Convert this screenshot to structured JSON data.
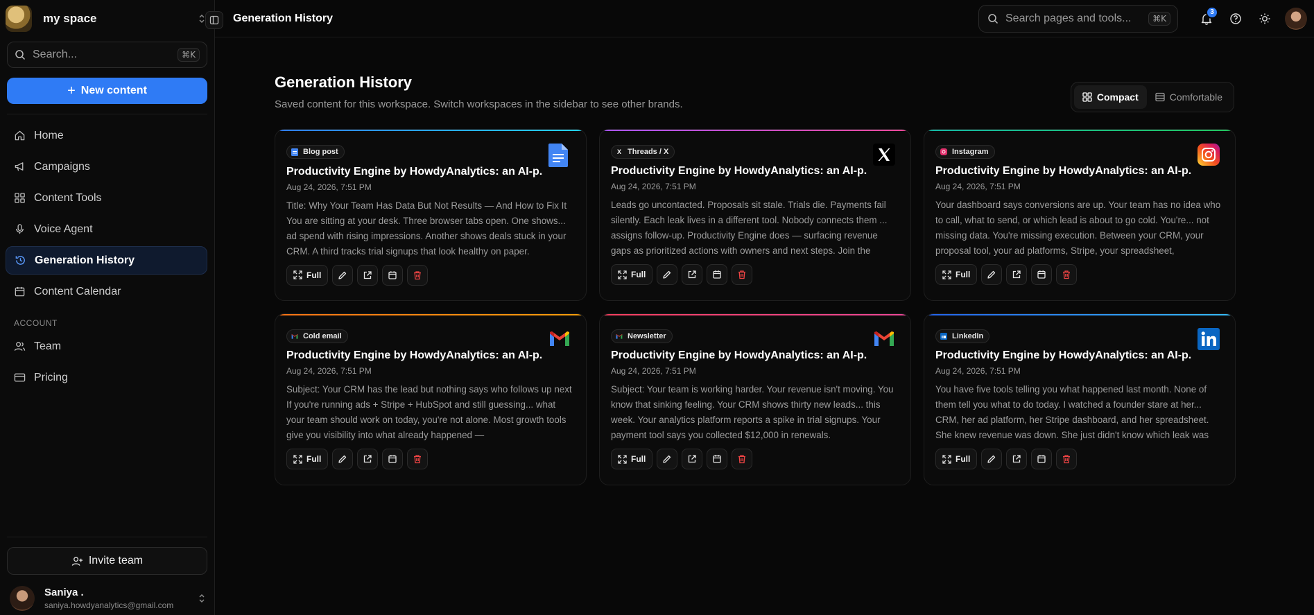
{
  "workspace": {
    "name": "my space"
  },
  "sidebar": {
    "search_placeholder": "Search...",
    "search_shortcut": "⌘K",
    "new_content_label": "New content",
    "nav": [
      {
        "label": "Home",
        "icon": "home-icon"
      },
      {
        "label": "Campaigns",
        "icon": "megaphone-icon"
      },
      {
        "label": "Content Tools",
        "icon": "grid-icon"
      },
      {
        "label": "Voice Agent",
        "icon": "mic-icon"
      },
      {
        "label": "Generation History",
        "icon": "history-icon",
        "active": true
      },
      {
        "label": "Content Calendar",
        "icon": "calendar-icon"
      }
    ],
    "account_label": "ACCOUNT",
    "account_nav": [
      {
        "label": "Team",
        "icon": "users-icon"
      },
      {
        "label": "Pricing",
        "icon": "card-icon"
      }
    ],
    "invite_label": "Invite team",
    "user": {
      "name": "Saniya .",
      "email": "saniya.howdyanalytics@gmail.com"
    }
  },
  "topbar": {
    "title": "Generation History",
    "search_placeholder": "Search pages and tools...",
    "search_shortcut": "⌘K",
    "notification_count": "3"
  },
  "page": {
    "title": "Generation History",
    "subtitle": "Saved content for this workspace. Switch workspaces in the sidebar to see other brands.",
    "view_compact": "Compact",
    "view_comfortable": "Comfortable"
  },
  "colors": {
    "accent": "#2f7bf5",
    "delete": "#ef4444"
  },
  "cards": [
    {
      "type": "Blog post",
      "icon": "google-docs-icon",
      "accent": "linear-gradient(90deg,#2f7bf5,#22d3ee)",
      "title": "Productivity Engine by HowdyAnalytics: an AI-p...",
      "date": "Aug 24, 2026, 7:51 PM",
      "body": "Title: Why Your Team Has Data But Not Results — And How to Fix It You are sitting at your desk. Three browser tabs open. One shows... ad spend with rising impressions. Another shows deals stuck in your CRM. A third tracks trial signups that look healthy on paper.",
      "full_label": "Full"
    },
    {
      "type": "Threads / X",
      "icon": "x-icon",
      "accent": "linear-gradient(90deg,#a855f7,#ec4899)",
      "title": "Productivity Engine by HowdyAnalytics: an AI-p...",
      "date": "Aug 24, 2026, 7:51 PM",
      "body": "Leads go uncontacted. Proposals sit stale. Trials die. Payments fail silently. Each leak lives in a different tool. Nobody connects them ... assigns follow-up. Productivity Engine does — surfacing revenue gaps as prioritized actions with owners and next steps. Join the",
      "full_label": "Full"
    },
    {
      "type": "Instagram",
      "icon": "instagram-icon",
      "accent": "linear-gradient(90deg,#14b8a6,#22c55e)",
      "title": "Productivity Engine by HowdyAnalytics: an AI-p...",
      "date": "Aug 24, 2026, 7:51 PM",
      "body": "Your dashboard says conversions are up. Your team has no idea who to call, what to send, or which lead is about to go cold. You're... not missing data. You're missing execution. Between your CRM, your proposal tool, your ad platforms, Stripe, your spreadsheet,",
      "full_label": "Full"
    },
    {
      "type": "Cold email",
      "icon": "gmail-icon",
      "accent": "linear-gradient(90deg,#f97316,#f59e0b)",
      "title": "Productivity Engine by HowdyAnalytics: an AI-p...",
      "date": "Aug 24, 2026, 7:51 PM",
      "body": "Subject: Your CRM has the lead but nothing says who follows up next If you're running ads + Stripe + HubSpot and still guessing... what your team should work on today, you're not alone. Most growth tools give you visibility into what already happened —",
      "full_label": "Full"
    },
    {
      "type": "Newsletter",
      "icon": "gmail-icon",
      "accent": "linear-gradient(90deg,#f43f5e,#ec4899)",
      "title": "Productivity Engine by HowdyAnalytics: an AI-p...",
      "date": "Aug 24, 2026, 7:51 PM",
      "body": "Subject: Your team is working harder. Your revenue isn't moving. You know that sinking feeling. Your CRM shows thirty new leads... this week. Your analytics platform reports a spike in trial signups. Your payment tool says you collected $12,000 in renewals.",
      "full_label": "Full"
    },
    {
      "type": "LinkedIn",
      "icon": "linkedin-icon",
      "accent": "linear-gradient(90deg,#2563eb,#38bdf8)",
      "title": "Productivity Engine by HowdyAnalytics: an AI-p...",
      "date": "Aug 24, 2026, 7:51 PM",
      "body": "You have five tools telling you what happened last month. None of them tell you what to do today. I watched a founder stare at her... CRM, her ad platform, her Stripe dashboard, and her spreadsheet. She knew revenue was down. She just didn't know which leak was",
      "full_label": "Full"
    }
  ]
}
